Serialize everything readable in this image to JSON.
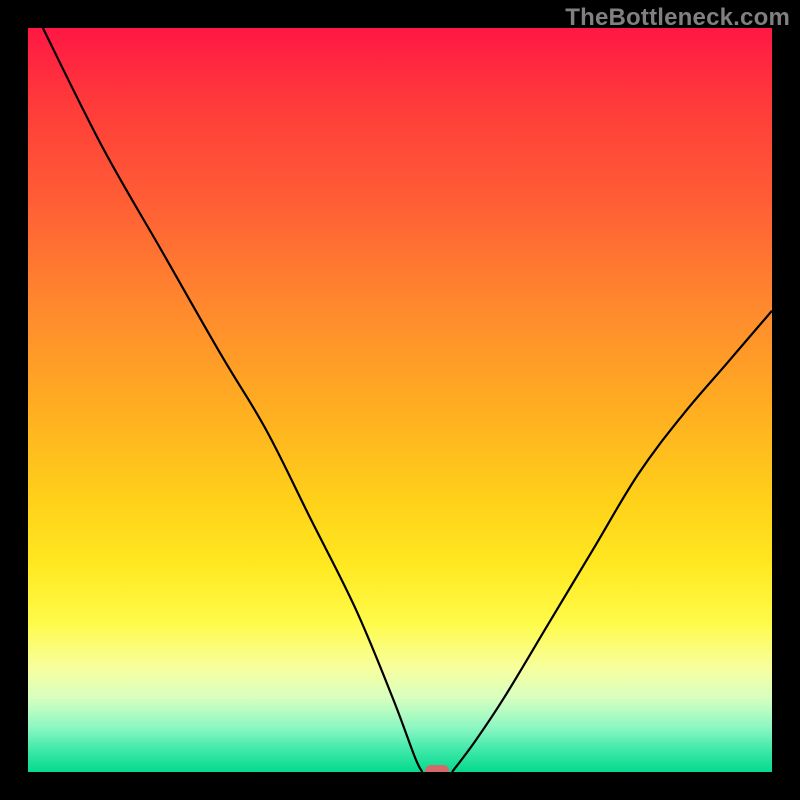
{
  "watermark": "TheBottleneck.com",
  "chart_data": {
    "type": "line",
    "title": "",
    "xlabel": "",
    "ylabel": "",
    "xlim": [
      0,
      100
    ],
    "ylim": [
      0,
      100
    ],
    "grid": false,
    "legend": false,
    "series": [
      {
        "name": "left-branch",
        "x": [
          2,
          10,
          18,
          26,
          32,
          38,
          44,
          49,
          52,
          53
        ],
        "y": [
          100,
          84,
          70,
          56,
          46,
          34,
          22,
          10,
          2,
          0
        ]
      },
      {
        "name": "right-branch",
        "x": [
          57,
          60,
          64,
          70,
          76,
          82,
          88,
          94,
          100
        ],
        "y": [
          0,
          4,
          10,
          20,
          30,
          40,
          48,
          55,
          62
        ]
      }
    ],
    "marker": {
      "name": "bottleneck-point",
      "x": 55,
      "y": 0,
      "color": "#d46a6a",
      "shape": "pill"
    },
    "background_gradient": {
      "stops": [
        {
          "pct": 0,
          "color": "#ff1744"
        },
        {
          "pct": 50,
          "color": "#ffb020"
        },
        {
          "pct": 80,
          "color": "#fffb4a"
        },
        {
          "pct": 100,
          "color": "#06d98f"
        }
      ]
    }
  }
}
